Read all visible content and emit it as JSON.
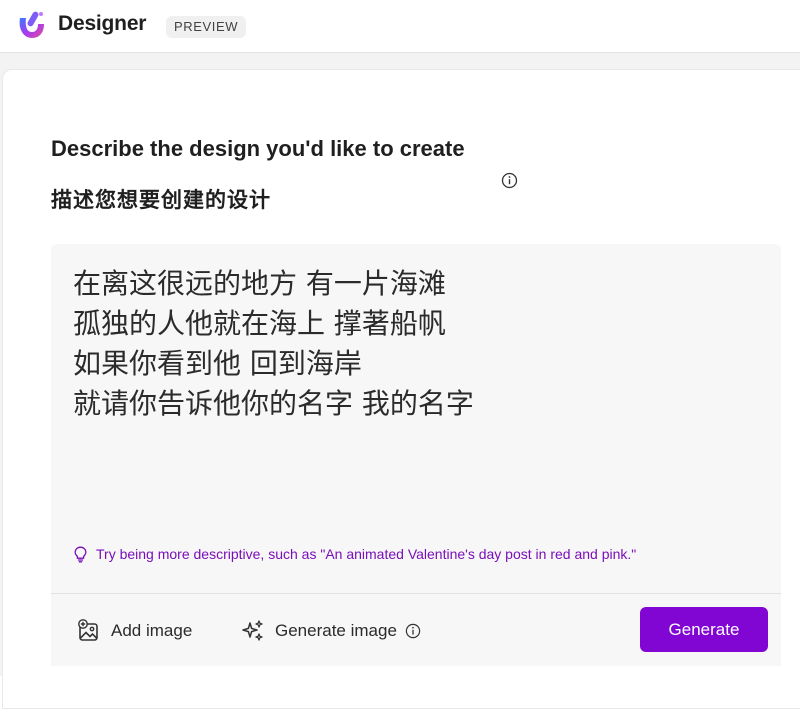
{
  "app": {
    "name": "Designer",
    "badge": "PREVIEW",
    "logo_icon": "designer-logo-icon",
    "accent_color": "#8106d4"
  },
  "main": {
    "heading_en": "Describe the design you'd like to create",
    "heading_zh": "描述您想要创建的设计",
    "prompt": {
      "value": "在离这很远的地方 有一片海滩\n孤独的人他就在海上 撑著船帆\n如果你看到他 回到海岸\n就请你告诉他你的名字 我的名字",
      "tip": "Try being more descriptive, such as \"An animated Valentine's day post in red and pink.\"",
      "tip_color": "#7a0fb8"
    },
    "toolbar": {
      "add_image_label": "Add image",
      "generate_image_label": "Generate image",
      "generate_label": "Generate"
    }
  }
}
